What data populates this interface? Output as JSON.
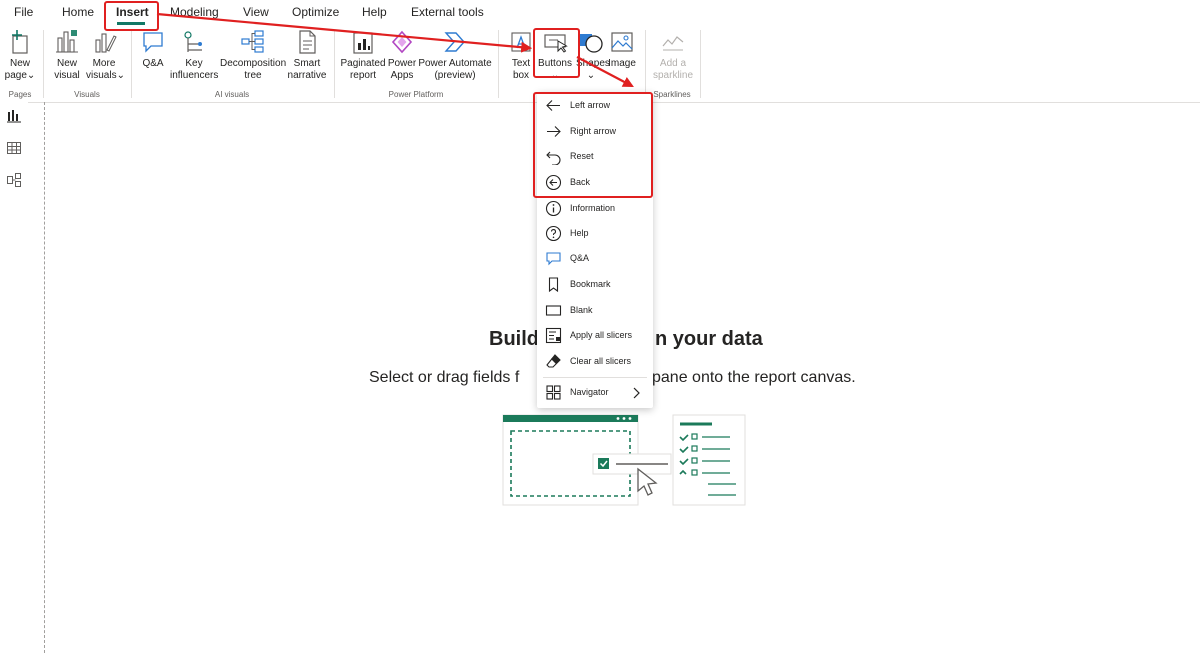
{
  "menu": {
    "file": "File",
    "home": "Home",
    "insert": "Insert",
    "modeling": "Modeling",
    "view": "View",
    "optimize": "Optimize",
    "help": "Help",
    "external_tools": "External tools"
  },
  "ribbon": {
    "new_page": [
      "New",
      "page"
    ],
    "new_visual": [
      "New",
      "visual"
    ],
    "more_visuals": [
      "More",
      "visuals"
    ],
    "qna": "Q&A",
    "key_influencers": [
      "Key",
      "influencers"
    ],
    "decomposition_tree": [
      "Decomposition",
      "tree"
    ],
    "smart_narrative": [
      "Smart",
      "narrative"
    ],
    "paginated_report": [
      "Paginated",
      "report"
    ],
    "power_apps": [
      "Power",
      "Apps"
    ],
    "power_automate": [
      "Power Automate",
      "(preview)"
    ],
    "text_box": [
      "Text",
      "box"
    ],
    "buttons": "Buttons",
    "shapes": "Shapes",
    "image": "Image",
    "add_sparkline": [
      "Add a",
      "sparkline"
    ],
    "groups": {
      "pages": "Pages",
      "visuals": "Visuals",
      "ai_visuals": "AI visuals",
      "power_platform": "Power Platform",
      "sparklines": "Sparklines"
    }
  },
  "canvas": {
    "title_left": "Build",
    "title_right": "n your data",
    "subtitle_left": "Select or drag fields f",
    "subtitle_right": "pane onto the report canvas."
  },
  "buttons_menu": {
    "items": [
      {
        "label": "Left arrow",
        "icon": "left-arrow-icon"
      },
      {
        "label": "Right arrow",
        "icon": "right-arrow-icon"
      },
      {
        "label": "Reset",
        "icon": "reset-icon"
      },
      {
        "label": "Back",
        "icon": "back-icon"
      },
      {
        "label": "Information",
        "icon": "information-icon"
      },
      {
        "label": "Help",
        "icon": "help-icon"
      },
      {
        "label": "Q&A",
        "icon": "qna-icon"
      },
      {
        "label": "Bookmark",
        "icon": "bookmark-icon"
      },
      {
        "label": "Blank",
        "icon": "blank-icon"
      },
      {
        "label": "Apply all slicers",
        "icon": "apply-slicers-icon"
      },
      {
        "label": "Clear all slicers",
        "icon": "eraser-icon"
      },
      {
        "label": "Navigator",
        "icon": "navigator-icon"
      }
    ]
  },
  "colors": {
    "accent": "#117865",
    "annotation": "#e02020",
    "illustration": "#1b7a5a"
  }
}
